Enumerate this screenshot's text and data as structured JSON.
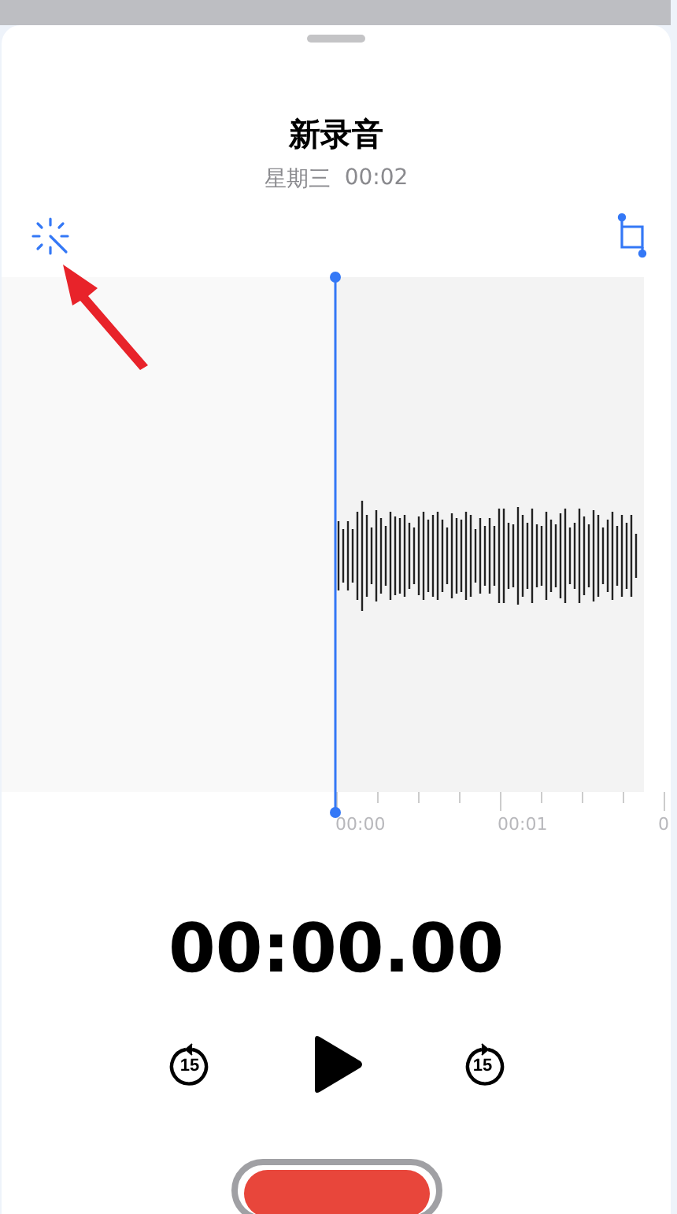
{
  "sheet": {
    "title": "新录音",
    "date": "星期三",
    "duration": "00:02"
  },
  "timeline": {
    "labels": [
      "00:00",
      "00:01",
      "0"
    ]
  },
  "timer": "00:00.00",
  "controls": {
    "skip_back": "15",
    "skip_forward": "15"
  }
}
